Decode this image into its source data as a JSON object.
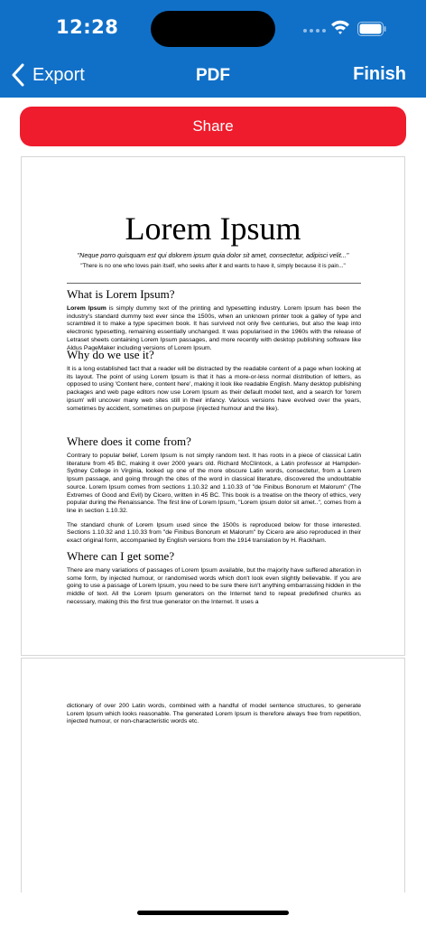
{
  "status": {
    "time": "12:28"
  },
  "nav": {
    "back_label": "Export",
    "title": "PDF",
    "finish_label": "Finish"
  },
  "share": {
    "label": "Share"
  },
  "colors": {
    "header": "#1070c8",
    "share_button": "#ee1c2c"
  },
  "document": {
    "title": "Lorem Ipsum",
    "quote": "\"Neque porro quisquam est qui dolorem ipsum quia dolor sit amet, consectetur, adipisci velit...\"",
    "subquote": "\"There is no one who loves pain itself, who seeks after it and wants to have it, simply because it is pain...\"",
    "sections": [
      {
        "heading": "What is Lorem Ipsum?",
        "lead_bold": "Lorem Ipsum",
        "body": " is simply dummy text of the printing and typesetting industry. Lorem Ipsum has been the industry's standard dummy text ever since the 1500s, when an unknown printer took a galley of type and scrambled it to make a type specimen book. It has survived not only five centuries, but also the leap into electronic typesetting, remaining essentially unchanged. It was popularised in the 1960s with the release of Letraset sheets containing Lorem Ipsum passages, and more recently with desktop publishing software like Aldus PageMaker including versions of Lorem Ipsum."
      },
      {
        "heading": "Why do we use it?",
        "body": "It is a long established fact that a reader will be distracted by the readable content of a page when looking at its layout. The point of using Lorem Ipsum is that it has a more-or-less normal distribution of letters, as opposed to using 'Content here, content here', making it look like readable English. Many desktop publishing packages and web page editors now use Lorem Ipsum as their default model text, and a search for 'lorem ipsum' will uncover many web sites still in their infancy. Various versions have evolved over the years, sometimes by accident, sometimes on purpose (injected humour and the like)."
      },
      {
        "heading": "Where does it come from?",
        "body": "Contrary to popular belief, Lorem Ipsum is not simply random text. It has roots in a piece of classical Latin literature from 45 BC, making it over 2000 years old. Richard McClintock, a Latin professor at Hampden-Sydney College in Virginia, looked up one of the more obscure Latin words, consectetur, from a Lorem Ipsum passage, and going through the cites of the word in classical literature, discovered the undoubtable source. Lorem Ipsum comes from sections 1.10.32 and 1.10.33 of \"de Finibus Bonorum et Malorum\" (The Extremes of Good and Evil) by Cicero, written in 45 BC. This book is a treatise on the theory of ethics, very popular during the Renaissance. The first line of Lorem Ipsum, \"Lorem ipsum dolor sit amet..\", comes from a line in section 1.10.32.",
        "body2": "The standard chunk of Lorem Ipsum used since the 1500s is reproduced below for those interested. Sections 1.10.32 and 1.10.33 from \"de Finibus Bonorum et Malorum\" by Cicero are also reproduced in their exact original form, accompanied by English versions from the 1914 translation by H. Rackham."
      },
      {
        "heading": "Where can I get some?",
        "body": "There are many variations of passages of Lorem Ipsum available, but the majority have suffered alteration in some form, by injected humour, or randomised words which don't look even slightly believable. If you are going to use a passage of Lorem Ipsum, you need to be sure there isn't anything embarrassing hidden in the middle of text. All the Lorem Ipsum generators on the Internet tend to repeat predefined chunks as necessary, making this the first true generator on the Internet. It uses a"
      }
    ],
    "page2_text": "dictionary of over 200 Latin words, combined with a handful of model sentence structures, to generate Lorem Ipsum which looks reasonable. The generated Lorem Ipsum is therefore always free from repetition, injected humour, or non-characteristic words etc."
  }
}
